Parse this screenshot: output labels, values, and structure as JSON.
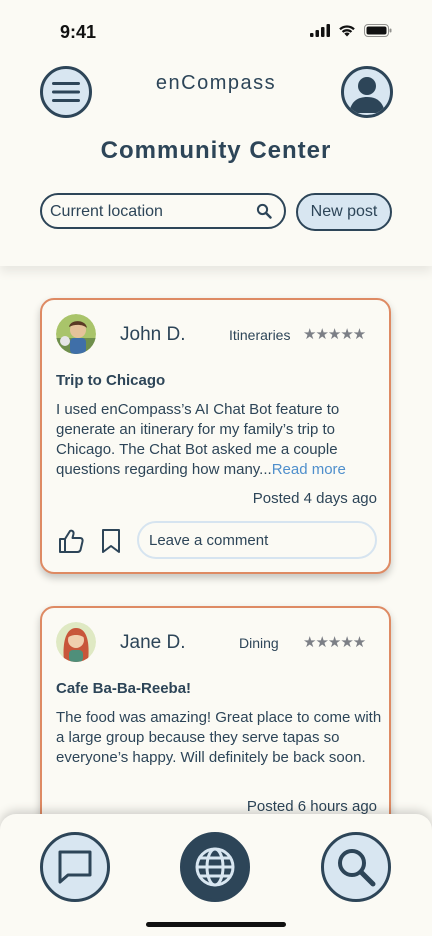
{
  "status_bar": {
    "time": "9:41",
    "icons": [
      "cellular-signal-icon",
      "wifi-icon",
      "battery-icon"
    ]
  },
  "header": {
    "brand": "enCompass",
    "title": "Community Center",
    "menu_icon": "hamburger-menu-icon",
    "profile_icon": "user-profile-icon",
    "search": {
      "placeholder": "Current location",
      "icon": "search-icon"
    },
    "new_post_label": "New post"
  },
  "posts": [
    {
      "author": "John D.",
      "category": "Itineraries",
      "stars": "★★★★★",
      "title": "Trip to Chicago",
      "body": "I used enCompass’s AI Chat Bot feature to generate an itinerary for my family’s trip to Chicago. The Chat Bot asked me a couple questions regarding how many...",
      "read_more": "Read more",
      "posted": "Posted 4 days ago",
      "comment_placeholder": "Leave a comment"
    },
    {
      "author": "Jane D.",
      "category": "Dining",
      "stars": "★★★★★",
      "title": "Cafe Ba-Ba-Reeba!",
      "body": "The food was amazing! Great place to come with a large group because they serve tapas so everyone’s happy. Will definitely be back soon.",
      "posted": "Posted 6 hours ago"
    }
  ],
  "bottom_nav": {
    "items": [
      {
        "icon": "chat-bubble-icon"
      },
      {
        "icon": "globe-icon"
      },
      {
        "icon": "magnifier-icon"
      }
    ]
  },
  "colors": {
    "background": "#fbfaf4",
    "primary": "#2d4558",
    "accent_light": "#d8e6f1",
    "card_border": "#de8a63",
    "link": "#4f8fcc"
  }
}
